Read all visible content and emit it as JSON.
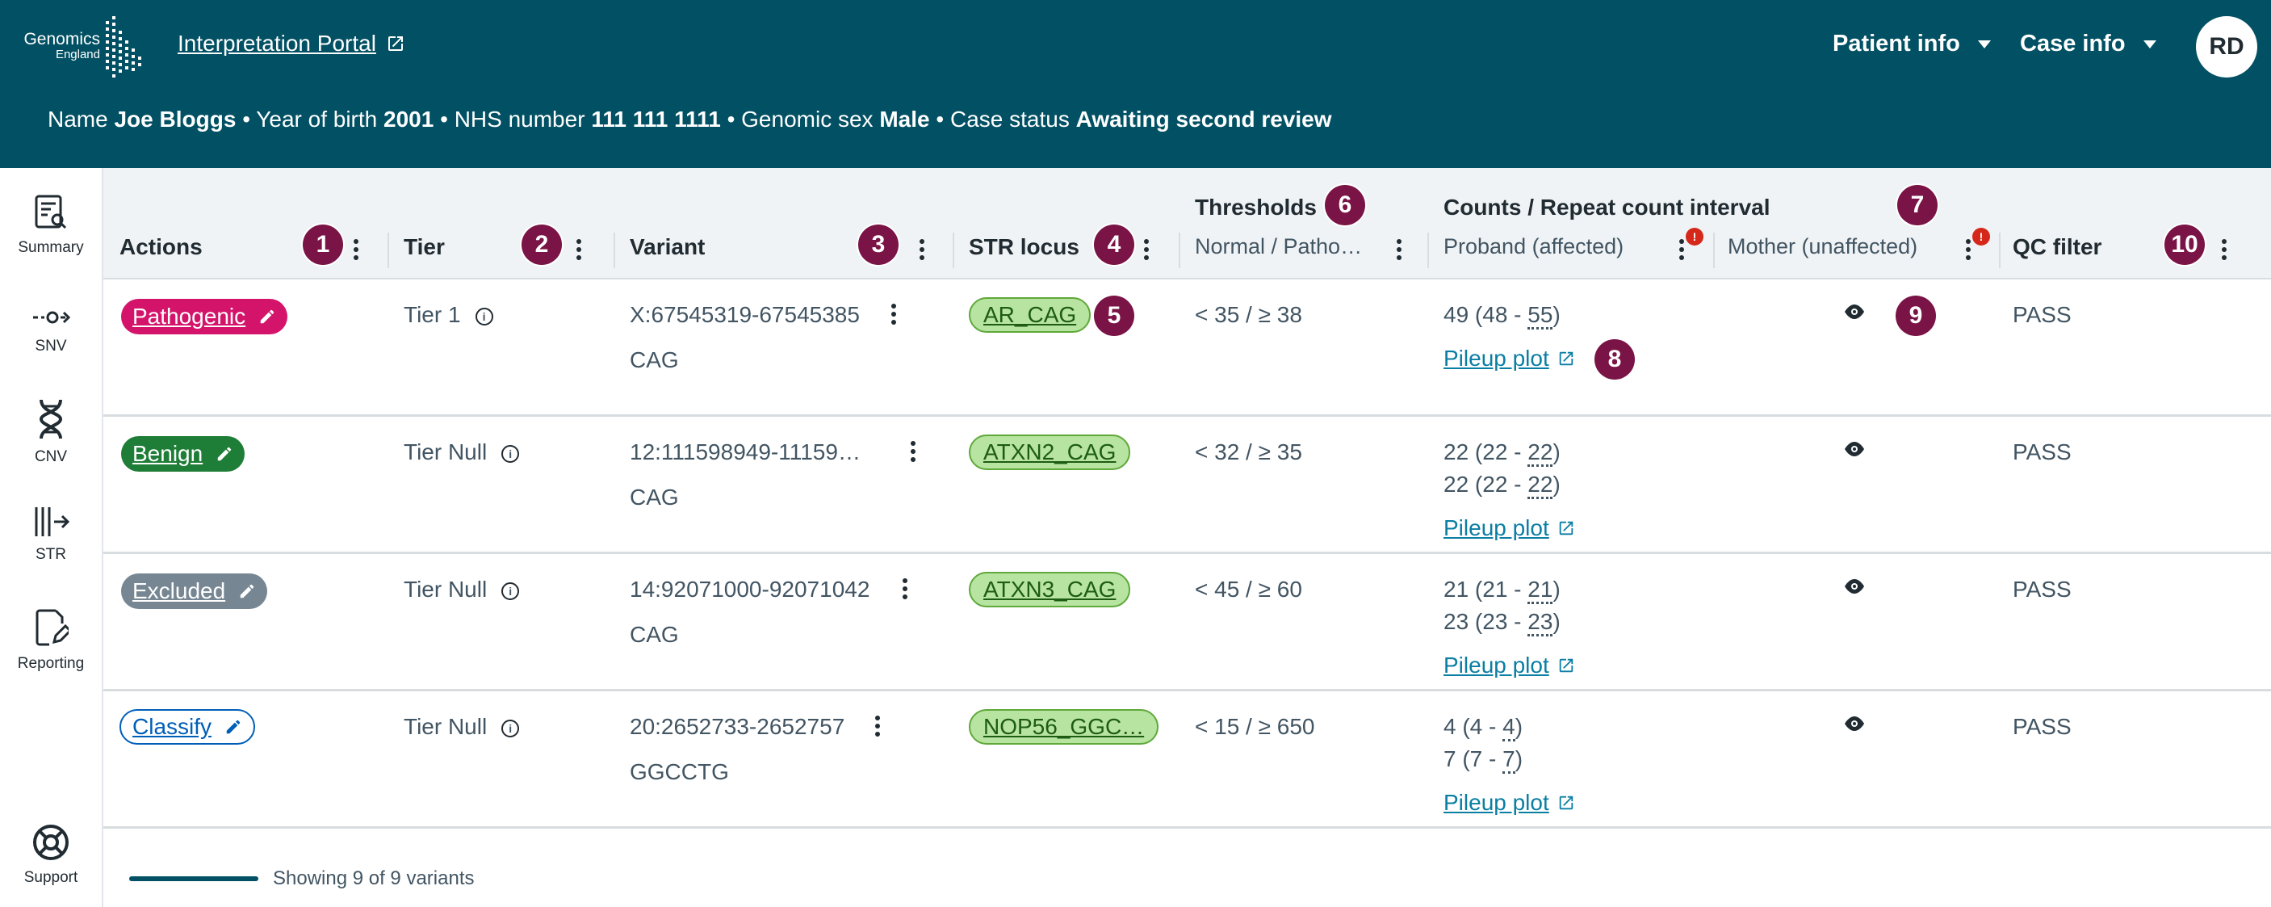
{
  "header": {
    "logo_line1": "Genomics",
    "logo_line2": "England",
    "portal_link": "Interpretation Portal",
    "menu_patient": "Patient info",
    "menu_case": "Case info",
    "avatar_initials": "RD",
    "brand_color": "#015063"
  },
  "patient": {
    "name_label": "Name",
    "name": "Joe Bloggs",
    "yob_label": "Year of birth",
    "yob": "2001",
    "nhs_label": "NHS number",
    "nhs": "111 111 1111",
    "sex_label": "Genomic sex",
    "sex": "Male",
    "status_label": "Case status",
    "status": "Awaiting second review",
    "separator": "•"
  },
  "sidebar": {
    "items": [
      {
        "label": "Summary",
        "icon": "summary-icon"
      },
      {
        "label": "SNV",
        "icon": "snv-icon"
      },
      {
        "label": "CNV",
        "icon": "dna-icon"
      },
      {
        "label": "STR",
        "icon": "str-icon"
      },
      {
        "label": "Reporting",
        "icon": "report-edit-icon"
      },
      {
        "label": "Support",
        "icon": "support-icon"
      }
    ]
  },
  "table": {
    "headers": {
      "actions": "Actions",
      "tier": "Tier",
      "variant": "Variant",
      "str_locus": "STR locus",
      "thresholds_group": "Thresholds",
      "thresholds_sub": "Normal / Patho…",
      "counts_group": "Counts / Repeat count interval",
      "proband": "Proband (affected)",
      "mother": "Mother (unaffected)",
      "qc": "QC filter"
    },
    "badge_numbers": [
      "1",
      "2",
      "3",
      "4",
      "5",
      "6",
      "7",
      "8",
      "9",
      "10"
    ],
    "alert_badge": "!",
    "rows": [
      {
        "action": "Pathogenic",
        "action_type": "pathogenic",
        "tier": "Tier 1",
        "variant": "X:67545319-67545385",
        "motif": "CAG",
        "locus": "AR_CAG",
        "threshold": "< 35 / ≥ 38",
        "counts": [
          [
            "49 (48 - ",
            "55",
            ")"
          ]
        ],
        "pileup": "Pileup plot",
        "qc": "PASS"
      },
      {
        "action": "Benign",
        "action_type": "benign",
        "tier": "Tier Null",
        "variant": "12:111598949-11159…",
        "motif": "CAG",
        "locus": "ATXN2_CAG",
        "threshold": "< 32 / ≥ 35",
        "counts": [
          [
            "22 (22 - ",
            "22",
            ")"
          ],
          [
            "22 (22 - ",
            "22",
            ")"
          ]
        ],
        "pileup": "Pileup plot",
        "qc": "PASS"
      },
      {
        "action": "Excluded",
        "action_type": "excluded",
        "tier": "Tier Null",
        "variant": "14:92071000-92071042",
        "motif": "CAG",
        "locus": "ATXN3_CAG",
        "threshold": "< 45 / ≥ 60",
        "counts": [
          [
            "21 (21 - ",
            "21",
            ")"
          ],
          [
            "23 (23 - ",
            "23",
            ")"
          ]
        ],
        "pileup": "Pileup plot",
        "qc": "PASS"
      },
      {
        "action": "Classify",
        "action_type": "classify",
        "tier": "Tier Null",
        "variant": "20:2652733-2652757",
        "motif": "GGCCTG",
        "locus": "NOP56_GGC…",
        "threshold": "< 15 / ≥ 650",
        "counts": [
          [
            "4 (4 - ",
            "4",
            ")"
          ],
          [
            "7 (7 - ",
            "7",
            ")"
          ]
        ],
        "pileup": "Pileup plot",
        "qc": "PASS"
      }
    ]
  },
  "footer": {
    "showing": "Showing 9 of 9 variants"
  }
}
